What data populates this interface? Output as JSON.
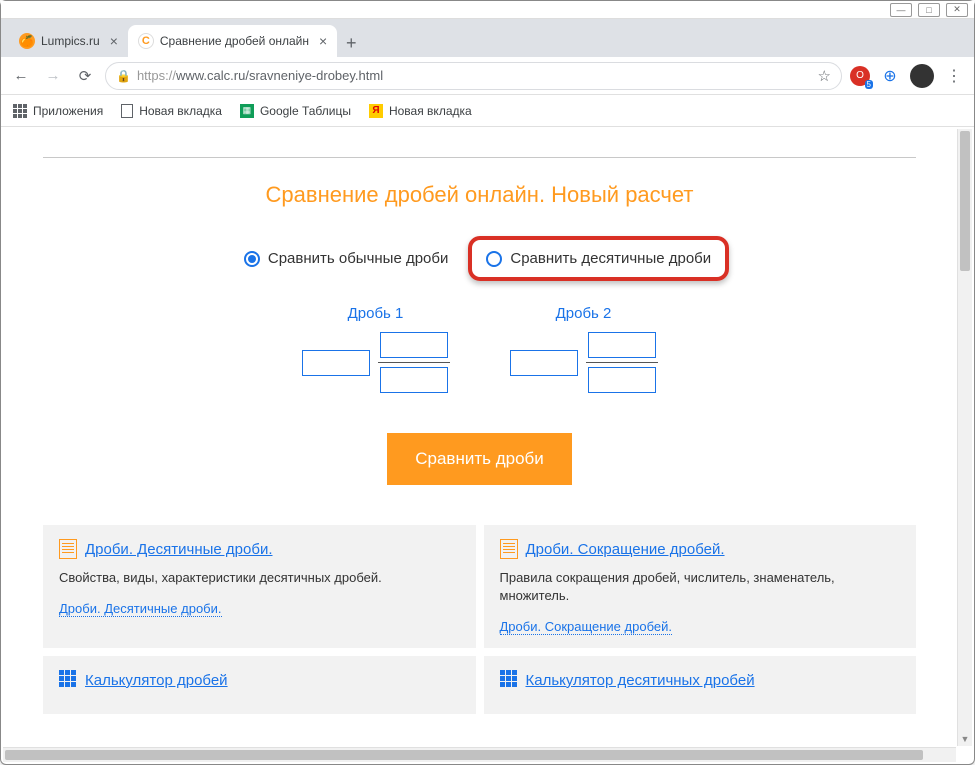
{
  "window": {
    "tabs": [
      {
        "title": "Lumpics.ru",
        "active": false
      },
      {
        "title": "Сравнение дробей онлайн",
        "active": true
      }
    ]
  },
  "toolbar": {
    "url_prefix": "https://",
    "url_rest": "www.calc.ru/sravneniye-drobey.html"
  },
  "bookmarks": {
    "apps": "Приложения",
    "items": [
      "Новая вкладка",
      "Google Таблицы",
      "Новая вкладка"
    ]
  },
  "avatar_badge": "5",
  "page": {
    "heading": "Сравнение дробей онлайн. Новый расчет",
    "radio": {
      "opt1": "Сравнить обычные дроби",
      "opt2": "Сравнить десятичные дроби"
    },
    "frac1_label": "Дробь 1",
    "frac2_label": "Дробь 2",
    "compare_btn": "Сравнить дроби",
    "cards": [
      {
        "title": "Дроби. Десятичные дроби.",
        "desc": "Свойства, виды, характеристики десятичных дробей.",
        "link": "Дроби. Десятичные дроби."
      },
      {
        "title": "Дроби. Сокращение дробей.",
        "desc": "Правила сокращения дробей, числитель, знаменатель, множитель.",
        "link": "Дроби. Сокращение дробей."
      },
      {
        "title": "Калькулятор дробей",
        "desc": "",
        "link": ""
      },
      {
        "title": "Калькулятор десятичных дробей",
        "desc": "",
        "link": ""
      }
    ]
  }
}
